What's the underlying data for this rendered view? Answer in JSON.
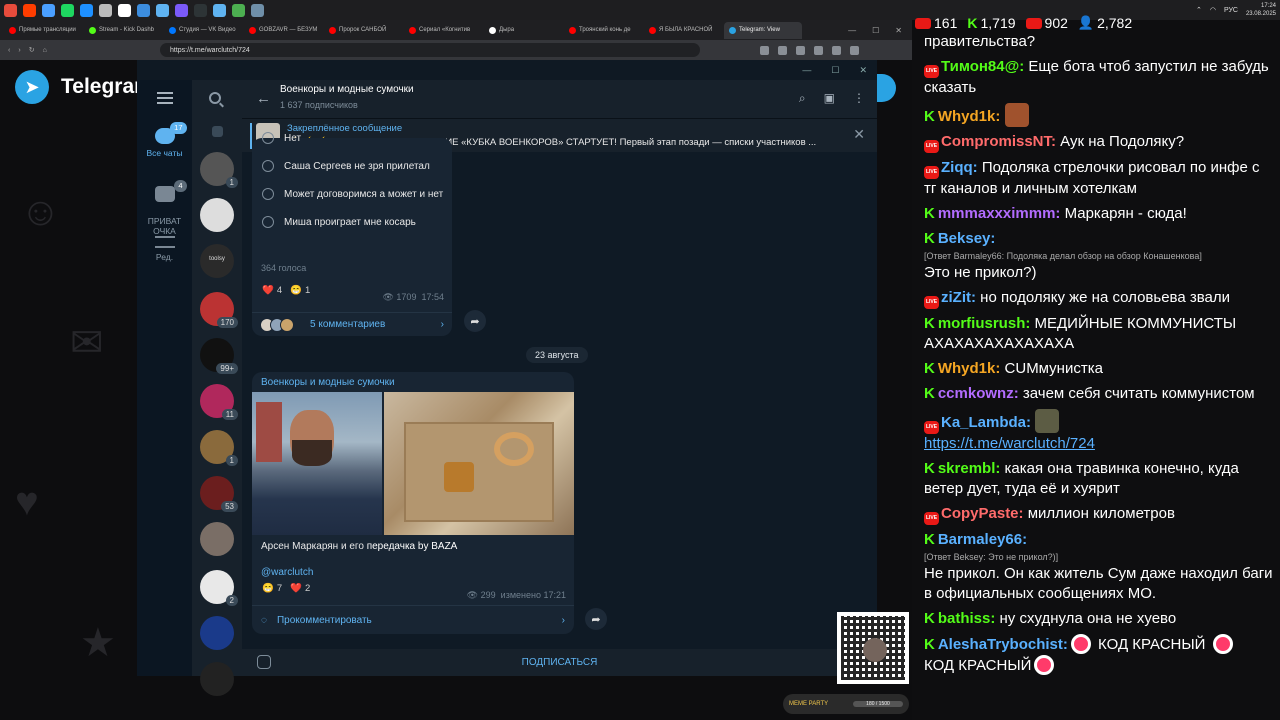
{
  "taskbar": {
    "icons": [
      "#e74c3c",
      "#ff3d00",
      "#4a9fff",
      "#1ed760",
      "#1e90ff",
      "#bbb",
      "#fff",
      "#3c8dde",
      "#5fb3f0",
      "#7a5af8",
      "#2d3436",
      "#5fb3f0",
      "#4caf50",
      "#6f8fa8"
    ],
    "clock_time": "17:24",
    "clock_date": "23.08.2025",
    "lang": "РУС"
  },
  "browser": {
    "tabs": [
      {
        "label": "Прямые трансляции",
        "color": "#ff0000"
      },
      {
        "label": "Stream - Kick Dashb",
        "color": "#53fc18"
      },
      {
        "label": "Студия — VK Видео",
        "color": "#0077ff"
      },
      {
        "label": "GOBZAVR — БЕЗУМ",
        "color": "#ff0000"
      },
      {
        "label": "Пророк САНБОЙ",
        "color": "#ff0000"
      },
      {
        "label": "Сериал «Когнитив",
        "color": "#ff0000"
      },
      {
        "label": "Дыра",
        "color": "#fff"
      },
      {
        "label": "Троянский конь де",
        "color": "#ff0000"
      },
      {
        "label": "Я БЫЛА КРАСНОЙ",
        "color": "#ff0000"
      },
      {
        "label": "Telegram: View",
        "color": "#2aa3e3"
      }
    ],
    "url": "https://t.me/warclutch/724"
  },
  "page": {
    "brand": "Telegram"
  },
  "telegram": {
    "folders": [
      {
        "label": "Все чаты",
        "badge": "17"
      },
      {
        "label": "ПРИВАТ\nОЧКА",
        "badge": "4"
      },
      {
        "label": "Ред.",
        "badge": ""
      }
    ],
    "chats": [
      {
        "color": "#555",
        "count": "1"
      },
      {
        "color": "#ddd",
        "count": ""
      },
      {
        "color": "#2a2a2a",
        "count": ""
      },
      {
        "color": "#b33",
        "count": "170"
      },
      {
        "color": "#111",
        "count": "99+"
      },
      {
        "color": "#b0285c",
        "count": "11"
      },
      {
        "color": "#8a6a3c",
        "count": "1"
      },
      {
        "color": "#6b1e1e",
        "count": "53"
      },
      {
        "color": "#7a6e66",
        "count": ""
      },
      {
        "color": "#e8e8e8",
        "count": "2"
      },
      {
        "color": "#1a3a8a",
        "count": ""
      },
      {
        "color": "#222",
        "count": ""
      }
    ],
    "saved_chat_label": "toolsy",
    "channel": {
      "title": "Военкоры и модные сумочки",
      "subscribers": "1 637 подписчиков"
    },
    "pinned": {
      "title": "Закреплённое сообщение",
      "text": "⚡ ⚡ ⚡ НАРОДНОЕ ГОЛОСОВАНИЕ «КУБКА ВОЕНКОРОВ» СТАРТУЕТ!   Первый этап позади — списки участников ..."
    },
    "poll": {
      "options": [
        "Нет",
        "Саша Сергеев не зря прилетал",
        "Может договоримся а может и нет",
        "Миша проиграет мне косарь"
      ],
      "votes": "364 голоса",
      "reactions": [
        {
          "emoji": "❤️",
          "count": "4"
        },
        {
          "emoji": "😁",
          "count": "1"
        }
      ],
      "views": "1709",
      "time": "17:54",
      "comments": "5 комментариев"
    },
    "date_separator": "23 августа",
    "post": {
      "author": "Военкоры и модные сумочки",
      "caption_a": "Арсен Маркарян и его ",
      "caption_b": "передачка by BAZA",
      "handle": "@warclutch",
      "reactions": [
        {
          "emoji": "😁",
          "count": "7"
        },
        {
          "emoji": "❤️",
          "count": "2"
        }
      ],
      "views": "299",
      "edited": "изменено 17:21",
      "comment_btn": "Прокомментировать"
    },
    "subscribe": "ПОДПИСАТЬСЯ"
  },
  "stream_chat": {
    "stats": {
      "live": "161",
      "kick": "1,719",
      "vk": "902",
      "viewers": "2,782"
    },
    "messages": [
      {
        "badge": "",
        "user": "",
        "color": "#fff",
        "text": "правительства?"
      },
      {
        "badge": "live",
        "user": "Тимон84@:",
        "color": "#53fc18",
        "text": " Еще бота чтоб запустил не забудь сказать"
      },
      {
        "badge": "k",
        "user": "Whyd1k:",
        "color": "#f5a623",
        "text": "",
        "emote": "#a0522d"
      },
      {
        "badge": "live",
        "user": "CompromissNT:",
        "color": "#ff6b6b",
        "text": " Аук на Подоляку?"
      },
      {
        "badge": "live",
        "user": "Ziqq:",
        "color": "#5ab1ff",
        "text": " Подоляка стрелочки рисовал по инфе с тг каналов и личным хотелкам"
      },
      {
        "badge": "k",
        "user": "mmmaxxximmm:",
        "color": "#b36cff",
        "text": " Маркарян - сюда!"
      },
      {
        "badge": "k",
        "user": "Beksey:",
        "color": "#5ab1ff",
        "reply": "[Ответ Barmaley66: Подоляка делал обзор на обзор Конашенкова]",
        "text": "Это не прикол?)"
      },
      {
        "badge": "live",
        "user": "ziZit:",
        "color": "#5ab1ff",
        "text": " но подоляку же на соловьева звали"
      },
      {
        "badge": "k",
        "user": "morfiusrush:",
        "color": "#53fc18",
        "text": " МЕДИЙНЫЕ КОММУНИСТЫ АХАХАХАХАХАХАХА"
      },
      {
        "badge": "k",
        "user": "Whyd1k:",
        "color": "#f5a623",
        "text": " CUMмунистка"
      },
      {
        "badge": "k",
        "user": "ccmkownz:",
        "color": "#b36cff",
        "text": " зачем себя считать коммунистом"
      },
      {
        "badge": "live",
        "user": "Ka_Lambda:",
        "color": "#5ab1ff",
        "text": "",
        "emote": "#5c5c44",
        "link": "https://t.me/warclutch/724"
      },
      {
        "badge": "k",
        "user": "skrembl:",
        "color": "#53fc18",
        "text": " какая она травинка конечно, куда ветер дует, туда её и хуярит"
      },
      {
        "badge": "live",
        "user": "CopyPaste:",
        "color": "#ff6b6b",
        "text": " миллион километров"
      },
      {
        "badge": "k",
        "user": "Barmaley66:",
        "color": "#5ab1ff",
        "reply": "[Ответ Beksey: Это не прикол?)]",
        "text": "Не прикол. Он как житель Сум даже находил баги в официальных сообщениях МО."
      },
      {
        "badge": "k",
        "user": "bathiss:",
        "color": "#53fc18",
        "text": " ну схуднула она не хуево"
      },
      {
        "badge": "k",
        "user": "AleshaTrybochist:",
        "color": "#5ab1ff",
        "text_a": " КОД КРАСНЫЙ ",
        "text_b": "КОД КРАСНЫЙ",
        "red": true
      }
    ]
  },
  "overlay": {
    "meme_title": "MEME PARTY",
    "meme_progress": "180 / 1500"
  }
}
